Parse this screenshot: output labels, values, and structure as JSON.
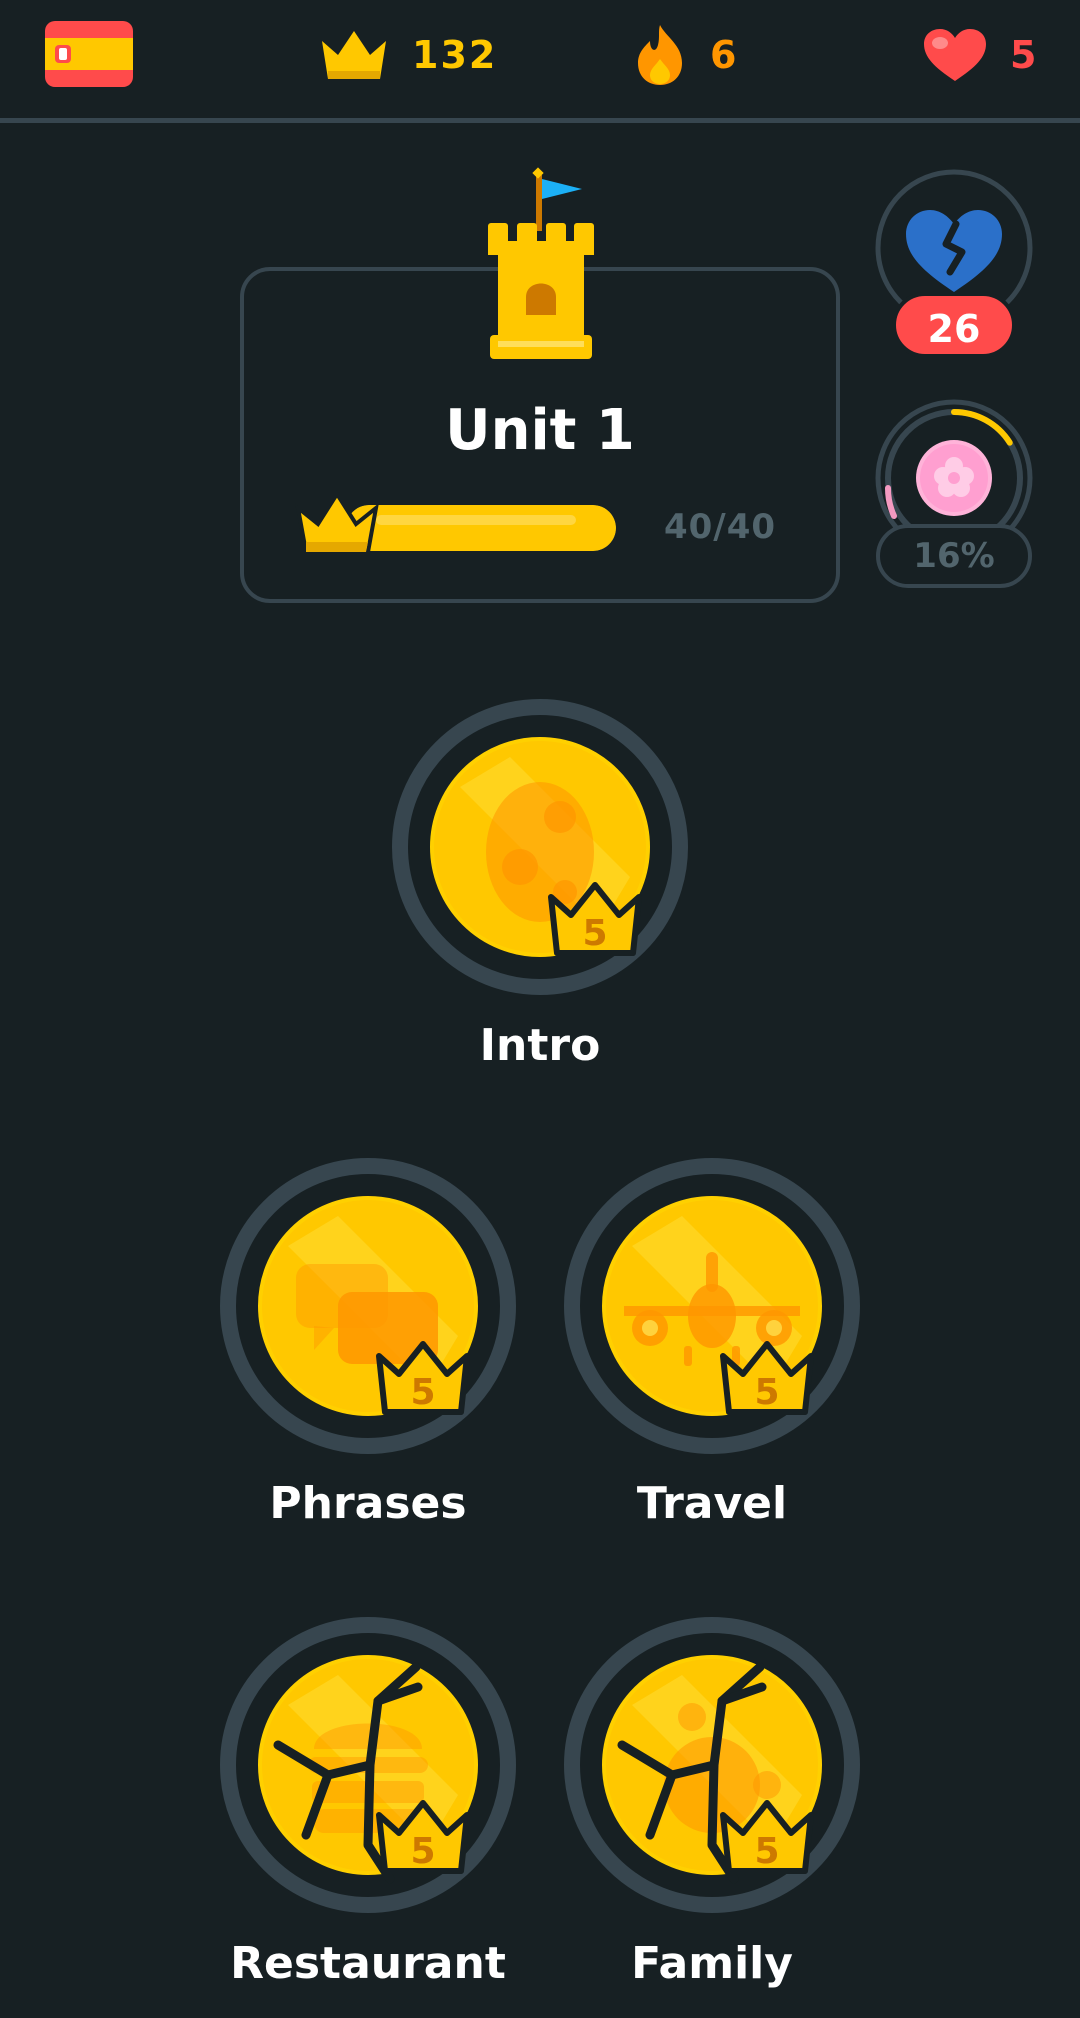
{
  "header": {
    "language_flag": "spain-flag-icon",
    "crowns": "132",
    "streak": "6",
    "hearts": "5",
    "colors": {
      "crowns": "#ffc800",
      "streak": "#ff9600",
      "hearts": "#ff4b4b"
    }
  },
  "unit": {
    "title": "Unit 1",
    "progress_text": "40/40",
    "progress_fraction": 1.0
  },
  "side": {
    "broken_heart_count": "26",
    "achievement_percent": "16%",
    "achievement_fraction": 0.16
  },
  "skills": [
    {
      "label": "Intro",
      "level": "5",
      "icon": "egg-icon",
      "cracked": false
    },
    {
      "label": "Phrases",
      "level": "5",
      "icon": "chat-bubbles-icon",
      "cracked": false
    },
    {
      "label": "Travel",
      "level": "5",
      "icon": "airplane-icon",
      "cracked": false
    },
    {
      "label": "Restaurant",
      "level": "5",
      "icon": "burger-icon",
      "cracked": true
    },
    {
      "label": "Family",
      "level": "5",
      "icon": "family-icon",
      "cracked": true
    }
  ]
}
